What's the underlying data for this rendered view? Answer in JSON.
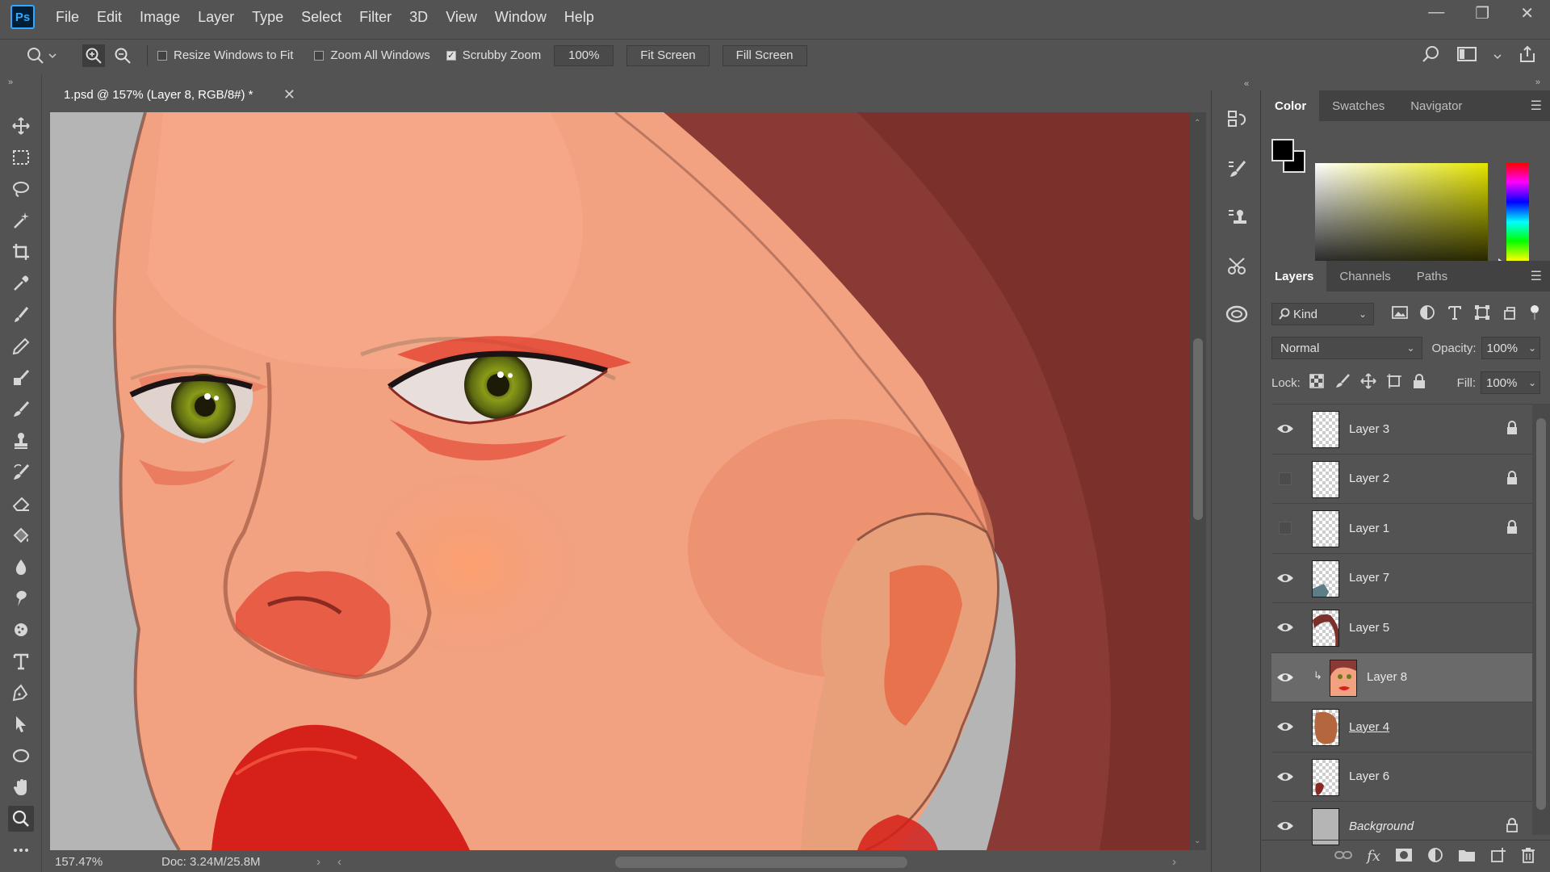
{
  "app": {
    "logo": "Ps"
  },
  "menu": [
    "File",
    "Edit",
    "Image",
    "Layer",
    "Type",
    "Select",
    "Filter",
    "3D",
    "View",
    "Window",
    "Help"
  ],
  "options": {
    "resize_windows": "Resize Windows to Fit",
    "zoom_all": "Zoom All Windows",
    "scrubby_zoom": "Scrubby Zoom",
    "zoom_value": "100%",
    "fit_screen": "Fit Screen",
    "fill_screen": "Fill Screen"
  },
  "document": {
    "tab_title": "1.psd @ 157% (Layer 8, RGB/8#) *",
    "zoom_status": "157.47%",
    "doc_size": "Doc: 3.24M/25.8M"
  },
  "color_panel": {
    "tabs": [
      "Color",
      "Swatches",
      "Navigator"
    ],
    "foreground": "#000000",
    "background": "#000000"
  },
  "layers_panel": {
    "tabs": [
      "Layers",
      "Channels",
      "Paths"
    ],
    "filter": "Kind",
    "blend_mode": "Normal",
    "opacity_label": "Opacity:",
    "opacity": "100%",
    "lock_label": "Lock:",
    "fill_label": "Fill:",
    "fill": "100%",
    "layers": [
      {
        "name": "Layer 3",
        "visible": true,
        "locked": true
      },
      {
        "name": "Layer 2",
        "visible": false,
        "locked": true
      },
      {
        "name": "Layer 1",
        "visible": false,
        "locked": true
      },
      {
        "name": "Layer 7",
        "visible": true,
        "locked": false
      },
      {
        "name": "Layer 5",
        "visible": true,
        "locked": false
      },
      {
        "name": "Layer 8",
        "visible": true,
        "locked": false,
        "selected": true,
        "clipped": true
      },
      {
        "name": "Layer 4",
        "visible": true,
        "locked": false
      },
      {
        "name": "Layer 6",
        "visible": true,
        "locked": false
      },
      {
        "name": "Background",
        "visible": true,
        "locked": true
      }
    ]
  }
}
